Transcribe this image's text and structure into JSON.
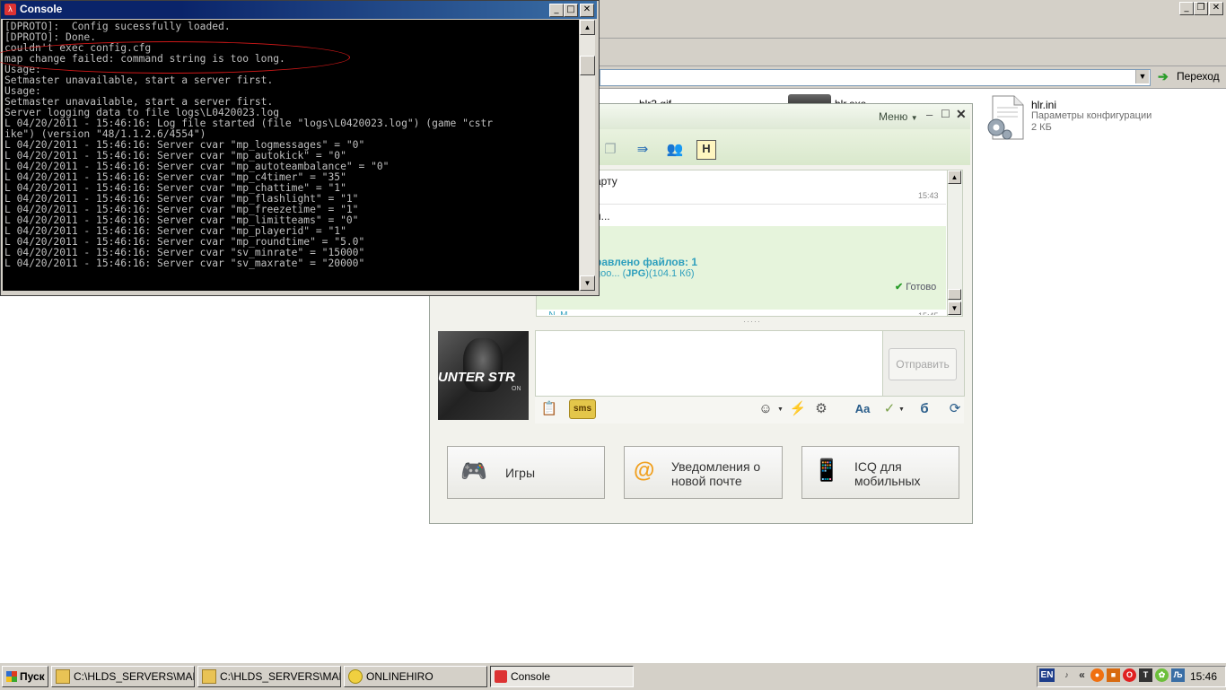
{
  "explorer": {
    "go_label": "Переход",
    "files": [
      {
        "name": "hlr.ini",
        "type": "Параметры конфигурации",
        "size": "2 КБ"
      },
      {
        "name": "hlr3.gif"
      },
      {
        "name": "hlr.exe"
      }
    ]
  },
  "console": {
    "title": "Console",
    "lines": [
      "[DPROTO]:  Config sucessfully loaded.",
      "[DPROTO]: Done.",
      "couldn't exec config.cfg",
      "map change failed: command string is too long.",
      "Usage:",
      "Setmaster unavailable, start a server first.",
      "Usage:",
      "Setmaster unavailable, start a server first.",
      "Server logging data to file logs\\L0420023.log",
      "L 04/20/2011 - 15:46:16: Log file started (file \"logs\\L0420023.log\") (game \"cstr",
      "ike\") (version \"48/1.1.2.6/4554\")",
      "L 04/20/2011 - 15:46:16: Server cvar \"mp_logmessages\" = \"0\"",
      "L 04/20/2011 - 15:46:16: Server cvar \"mp_autokick\" = \"0\"",
      "L 04/20/2011 - 15:46:16: Server cvar \"mp_autoteambalance\" = \"0\"",
      "L 04/20/2011 - 15:46:16: Server cvar \"mp_c4timer\" = \"35\"",
      "L 04/20/2011 - 15:46:16: Server cvar \"mp_chattime\" = \"1\"",
      "L 04/20/2011 - 15:46:16: Server cvar \"mp_flashlight\" = \"1\"",
      "L 04/20/2011 - 15:46:16: Server cvar \"mp_freezetime\" = \"1\"",
      "L 04/20/2011 - 15:46:16: Server cvar \"mp_limitteams\" = \"0\"",
      "L 04/20/2011 - 15:46:16: Server cvar \"mp_playerid\" = \"1\"",
      "L 04/20/2011 - 15:46:16: Server cvar \"mp_roundtime\" = \"5.0\"",
      "L 04/20/2011 - 15:46:16: Server cvar \"sv_minrate\" = \"15000\"",
      "L 04/20/2011 - 15:46:16: Server cvar \"sv_maxrate\" = \"20000\"",
      "",
      "_"
    ]
  },
  "icq": {
    "menu_label": "Меню",
    "history": {
      "msg1_text": "арту",
      "msg1_time": "15:43",
      "msg2_text": "н...",
      "files_sent": "равлено файлов: 1",
      "file_line_a": "goo... (",
      "file_line_b": "JPG",
      "file_line_c": ")(104.1 Кб)",
      "done_label": "Готово",
      "next_sender": "...N..M...",
      "next_time": "15:45"
    },
    "send_label": "Отправить",
    "avatar_text": "UNTER STR",
    "avatar_sub": "ON",
    "tiles": [
      {
        "label": "Игры"
      },
      {
        "label_line1": "Уведомления о",
        "label_line2": "новой почте"
      },
      {
        "label_line1": "ICQ для",
        "label_line2": "мобильных"
      }
    ]
  },
  "taskbar": {
    "start_label": "Пуск",
    "tasks": [
      {
        "label": "C:\\HLDS_SERVERS\\MAN..."
      },
      {
        "label": "C:\\HLDS_SERVERS\\MAN..."
      },
      {
        "label": "ONLINEHIRO"
      },
      {
        "label": "Console"
      }
    ],
    "lang": "EN",
    "clock": "15:46"
  }
}
